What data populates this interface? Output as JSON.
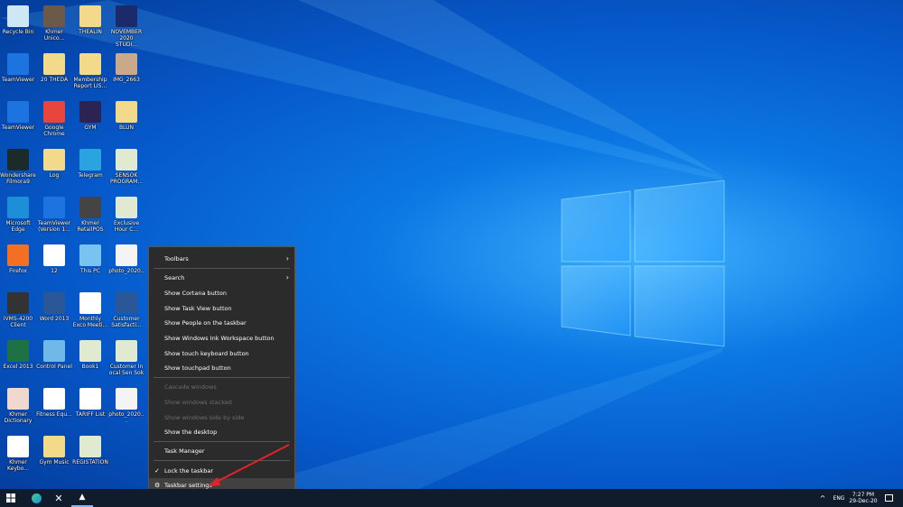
{
  "desktop_icons": [
    [
      "Recycle Bin",
      "Khmer Unico...",
      "THEALIN",
      "NOVEMBER 2020 STUDI..."
    ],
    [
      "TeamViewer",
      "20 THEDA",
      "Membership Report LIS...",
      "IMG_2663"
    ],
    [
      "TeamViewer",
      "Google Chrome",
      "GYM",
      "BLUN"
    ],
    [
      "Wondershare Filmora9",
      "Log",
      "Telegram",
      "SENSOK PROGRAM..."
    ],
    [
      "Microsoft Edge",
      "TeamViewer (Version 1...",
      "Khmer RetailPOS",
      "Exclusive Hour C..."
    ],
    [
      "Firefox",
      "12",
      "This PC",
      "photo_2020..."
    ],
    [
      "iVMS-4200 Client",
      "Word 2013",
      "Monthly Exco Meeti...",
      "Customer Satisfacti..."
    ],
    [
      "Excel 2013",
      "Control Panel",
      "Book1",
      "Customer In ocal Sen Sok"
    ],
    [
      "Khmer Dictionary",
      "Fitness Equ...",
      "TARIFF List",
      "photo_2020..."
    ],
    [
      "Khmer Keybo...",
      "Gym Music",
      "REGISTATION"
    ]
  ],
  "icon_colors": [
    [
      "#cfe6f5",
      "#6b5a4a",
      "#f3d98a",
      "#1b2a6b"
    ],
    [
      "#1d74e0",
      "#f3d98a",
      "#f3d98a",
      "#c9a98a"
    ],
    [
      "#1d74e0",
      "#e8453c",
      "#2b2352",
      "#f3d98a"
    ],
    [
      "#1d2a2a",
      "#f3d98a",
      "#2aa3e0",
      "#e0ead0"
    ],
    [
      "#1c8fd8",
      "#1d74e0",
      "#444",
      "#e0ead0"
    ],
    [
      "#f37022",
      "#ffffff",
      "#78c3f0",
      "#f4f4f4"
    ],
    [
      "#333",
      "#2b5797",
      "#ffffff",
      "#2b5797"
    ],
    [
      "#1e7145",
      "#6fb8e8",
      "#e0ead0",
      "#e0ead0"
    ],
    [
      "#f0d8d0",
      "#ffffff",
      "#ffffff",
      "#f4f4f4"
    ],
    [
      "#ffffff",
      "#f3d98a",
      "#e0ead0"
    ]
  ],
  "context_menu": {
    "items": [
      {
        "label": "Toolbars",
        "submenu": true
      },
      {
        "label": "Search",
        "submenu": true
      },
      {
        "label": "Show Cortana button"
      },
      {
        "label": "Show Task View button"
      },
      {
        "label": "Show People on the taskbar"
      },
      {
        "label": "Show Windows Ink Workspace button"
      },
      {
        "label": "Show touch keyboard button"
      },
      {
        "label": "Show touchpad button"
      },
      {
        "label": "Cascade windows",
        "disabled": true
      },
      {
        "label": "Show windows stacked",
        "disabled": true
      },
      {
        "label": "Show windows side by side",
        "disabled": true
      },
      {
        "label": "Show the desktop"
      },
      {
        "label": "Task Manager"
      },
      {
        "label": "Lock the taskbar",
        "checked": true
      },
      {
        "label": "Taskbar settings",
        "icon": "gear-icon",
        "highlighted": true
      }
    ]
  },
  "taskbar": {
    "language": "ENG",
    "time": "7:27 PM",
    "date": "29-Dec-20"
  },
  "annotation_color": "#e0242b"
}
